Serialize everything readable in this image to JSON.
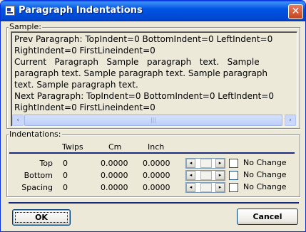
{
  "window": {
    "title": "Paragraph Indentations",
    "close_glyph": "✕"
  },
  "sample": {
    "group_label": "Sample:",
    "lines": [
      "Prev Paragraph: TopIndent=0 BottomIndent=0 LeftIndent=0",
      "RightIndent=0 FirstLineindent=0",
      "Current   Paragraph   Sample   paragraph   text.   Sample",
      "paragraph text. Sample paragraph text. Sample paragraph",
      "text. Sample paragraph text.",
      "Next Paragraph: TopIndent=0 BottomIndent=0 LeftIndent=0",
      "RightIndent=0 FirstLineindent=0"
    ],
    "scroll_left_glyph": "‹",
    "scroll_right_glyph": "›",
    "scroll_thumb_glyph": "|||"
  },
  "indentations": {
    "group_label": "Indentations:",
    "headers": {
      "twips": "Twips",
      "cm": "Cm",
      "inch": "Inch"
    },
    "rows": [
      {
        "label": "Top",
        "twips": "0",
        "cm": "0.0000",
        "inch": "0.0000",
        "no_change": "No Change"
      },
      {
        "label": "Bottom",
        "twips": "0",
        "cm": "0.0000",
        "inch": "0.0000",
        "no_change": "No Change"
      },
      {
        "label": "Spacing",
        "twips": "0",
        "cm": "0.0000",
        "inch": "0.0000",
        "no_change": "No Change"
      }
    ],
    "spin_left_glyph": "◂",
    "spin_right_glyph": "▸"
  },
  "buttons": {
    "ok": "OK",
    "cancel": "Cancel"
  },
  "colors": {
    "titlebar": "#0054e3",
    "separator": "#1b2a7c",
    "close": "#c4441f"
  }
}
